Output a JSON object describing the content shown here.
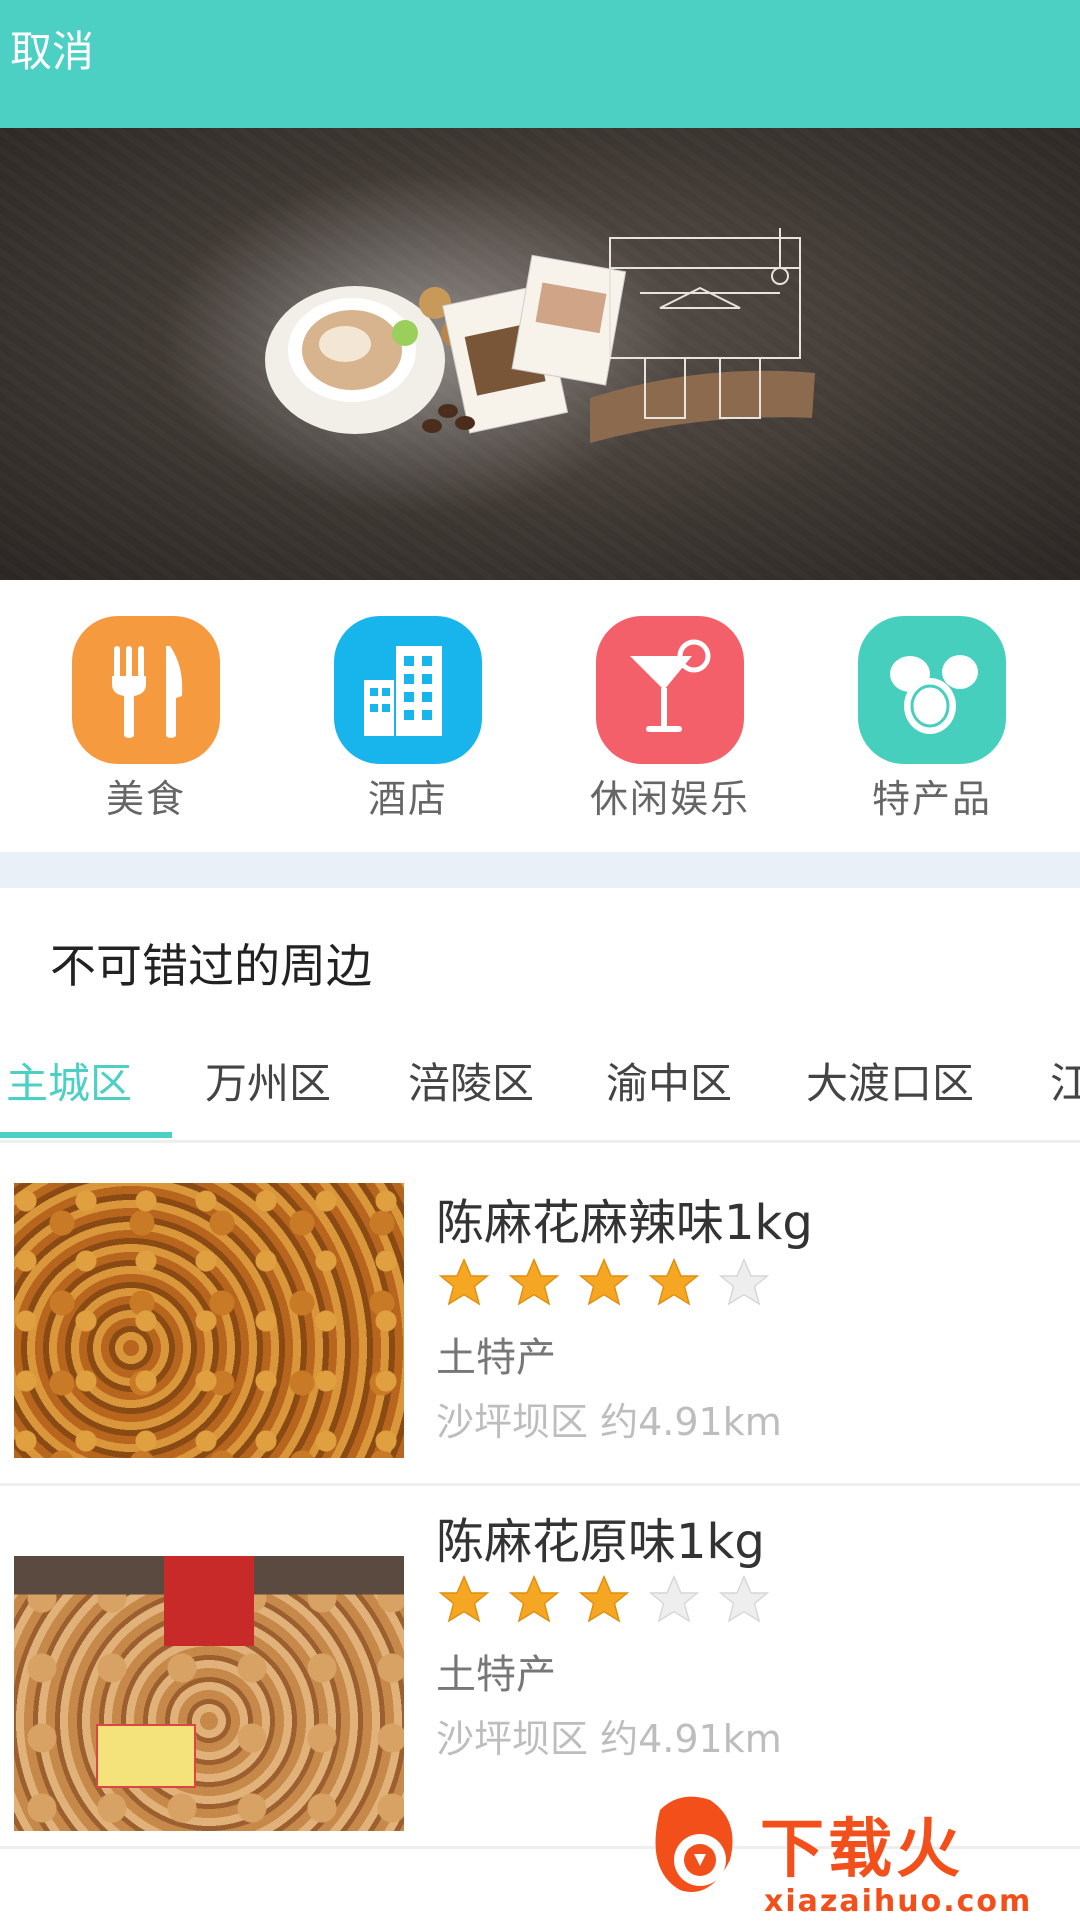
{
  "header": {
    "cancel_label": "取消",
    "bg_color": "#4dd0c4"
  },
  "banner": {
    "image": "coffee-shop-banner"
  },
  "categories": [
    {
      "label": "美食",
      "icon": "fork-knife-icon",
      "color": "#f69a3f"
    },
    {
      "label": "酒店",
      "icon": "hotel-building-icon",
      "color": "#18b4ec"
    },
    {
      "label": "休闲娱乐",
      "icon": "cocktail-icon",
      "color": "#f4606a"
    },
    {
      "label": "特产品",
      "icon": "nuts-icon",
      "color": "#47cfbd"
    }
  ],
  "section": {
    "title": "不可错过的周边"
  },
  "tabs": [
    {
      "label": "主城区",
      "active": true
    },
    {
      "label": "万州区",
      "active": false
    },
    {
      "label": "涪陵区",
      "active": false
    },
    {
      "label": "渝中区",
      "active": false
    },
    {
      "label": "大渡口区",
      "active": false
    },
    {
      "label": "江",
      "active": false
    }
  ],
  "items": [
    {
      "title": "陈麻花麻辣味1kg",
      "rating": 4,
      "max_rating": 5,
      "category": "土特产",
      "location": "沙坪坝区 约4.91km"
    },
    {
      "title": "陈麻花原味1kg",
      "rating": 3,
      "max_rating": 5,
      "category": "土特产",
      "location": "沙坪坝区 约4.91km"
    }
  ],
  "watermark": {
    "brand": "下载火",
    "url": "xiazaihuo.com"
  }
}
